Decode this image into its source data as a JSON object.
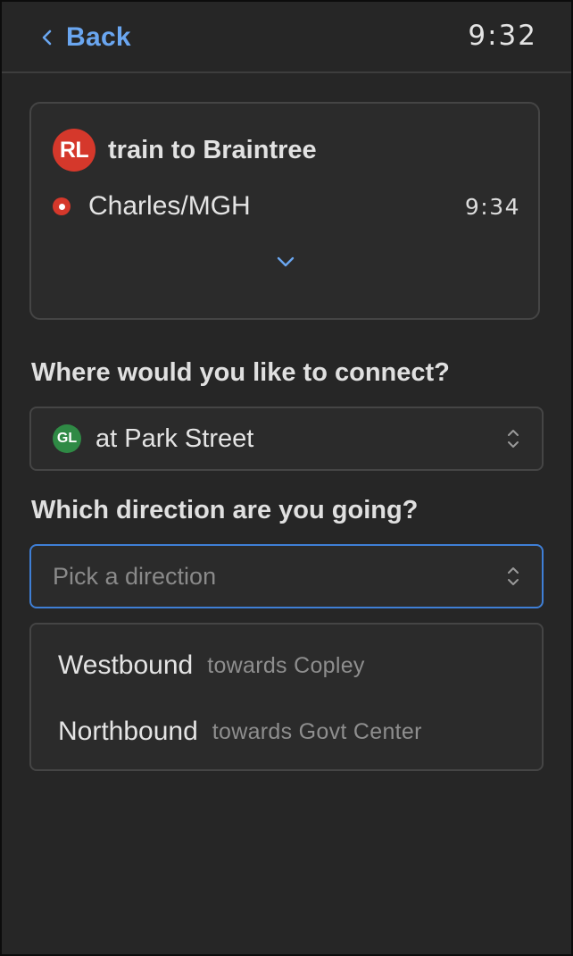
{
  "header": {
    "back_label": "Back",
    "time": "9:32"
  },
  "trip": {
    "route_badge": "RL",
    "route_label": "train to Braintree",
    "stop_name": "Charles/MGH",
    "stop_time": "9:34"
  },
  "connect": {
    "question": "Where would you like to connect?",
    "line_badge": "GL",
    "selected_value": "at Park Street"
  },
  "direction": {
    "question": "Which direction are you going?",
    "placeholder": "Pick a direction",
    "options": [
      {
        "label": "Westbound",
        "sublabel": "towards Copley"
      },
      {
        "label": "Northbound",
        "sublabel": "towards Govt Center"
      }
    ]
  },
  "colors": {
    "accent": "#6aa6f0",
    "focus_border": "#3f7fd6",
    "red_line": "#d5382b",
    "green_line": "#2f8a45",
    "background": "#262626"
  },
  "icons": {
    "back": "chevron-left-icon",
    "expand": "chevron-down-icon",
    "select": "chevron-up-down-icon"
  }
}
